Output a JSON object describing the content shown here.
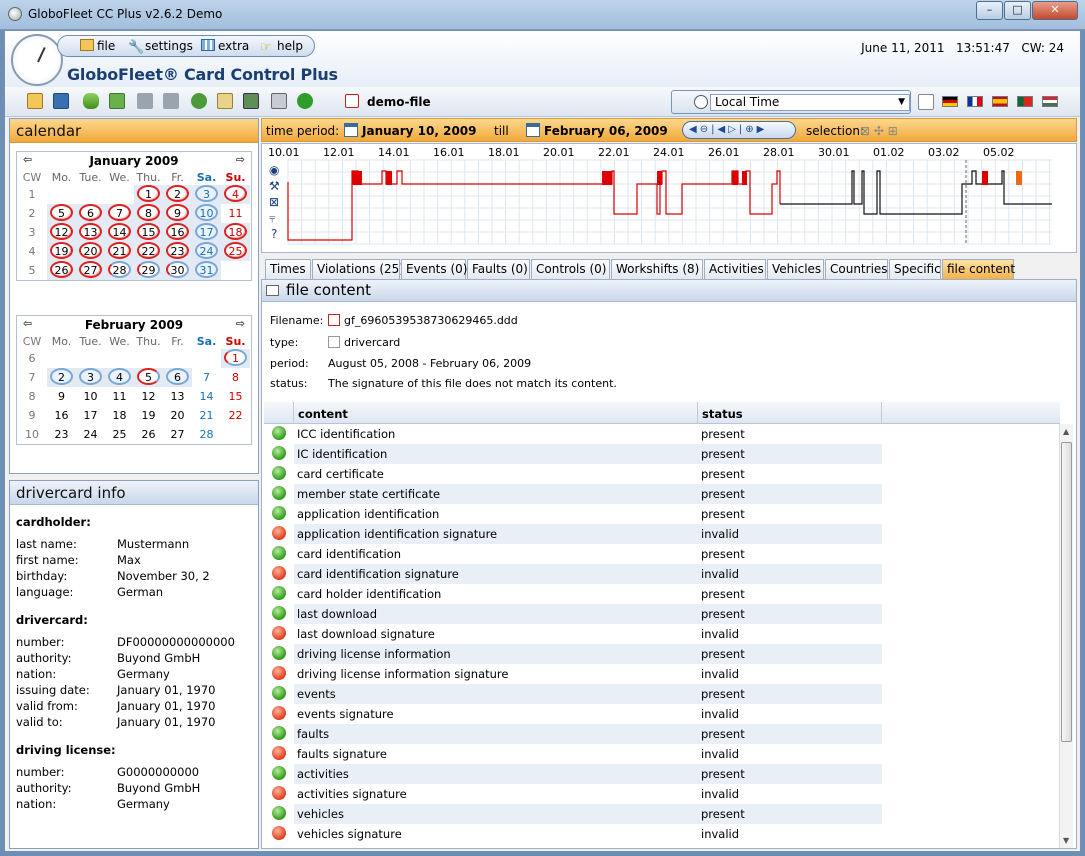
{
  "window": {
    "title": "GloboFleet CC Plus v2.6.2 Demo",
    "min": "–",
    "max": "□",
    "close": "✕"
  },
  "menu": {
    "file": "file",
    "settings": "settings",
    "extra": "extra",
    "help": "help"
  },
  "app_title": "GloboFleet® Card Control Plus",
  "header": {
    "date": "June 11, 2011",
    "time": "13:51:47",
    "cw": "CW: 24"
  },
  "toolbar": {
    "file_name": "demo-file",
    "timezone": "Local Time"
  },
  "calendar": {
    "title": "calendar",
    "weekdays": [
      "CW",
      "Mo.",
      "Tue.",
      "We.",
      "Thu.",
      "Fr.",
      "Sa.",
      "Su."
    ],
    "jan": {
      "title": "January 2009",
      "rows": [
        {
          "cw": "1",
          "days": [
            "",
            "",
            "",
            "1",
            "2",
            "3",
            "4"
          ],
          "s": [
            "",
            "",
            "",
            "r",
            "r",
            "b",
            "r"
          ]
        },
        {
          "cw": "2",
          "days": [
            "5",
            "6",
            "7",
            "8",
            "9",
            "10",
            "11"
          ],
          "s": [
            "r",
            "r",
            "r",
            "r",
            "r",
            "b",
            ""
          ]
        },
        {
          "cw": "3",
          "days": [
            "12",
            "13",
            "14",
            "15",
            "16",
            "17",
            "18"
          ],
          "s": [
            "r",
            "r",
            "r",
            "r",
            "r",
            "b",
            "r"
          ]
        },
        {
          "cw": "4",
          "days": [
            "19",
            "20",
            "21",
            "22",
            "23",
            "24",
            "25"
          ],
          "s": [
            "r",
            "r",
            "r",
            "r",
            "r",
            "b",
            "r"
          ]
        },
        {
          "cw": "5",
          "days": [
            "26",
            "27",
            "28",
            "29",
            "30",
            "31",
            ""
          ],
          "s": [
            "r",
            "r",
            "br",
            "br",
            "br",
            "b",
            ""
          ]
        }
      ]
    },
    "feb": {
      "title": "February 2009",
      "rows": [
        {
          "cw": "6",
          "days": [
            "",
            "",
            "",
            "",
            "",
            "",
            "1"
          ],
          "s": [
            "",
            "",
            "",
            "",
            "",
            "",
            "br"
          ]
        },
        {
          "cw": "7",
          "days": [
            "2",
            "3",
            "4",
            "5",
            "6",
            "7",
            "8"
          ],
          "s": [
            "b",
            "b",
            "b",
            "rb",
            "b",
            "",
            ""
          ]
        },
        {
          "cw": "8",
          "days": [
            "9",
            "10",
            "11",
            "12",
            "13",
            "14",
            "15"
          ],
          "s": [
            "",
            "",
            "",
            "",
            "",
            "",
            ""
          ]
        },
        {
          "cw": "9",
          "days": [
            "16",
            "17",
            "18",
            "19",
            "20",
            "21",
            "22"
          ],
          "s": [
            "",
            "",
            "",
            "",
            "",
            "",
            ""
          ]
        },
        {
          "cw": "10",
          "days": [
            "23",
            "24",
            "25",
            "26",
            "27",
            "28",
            ""
          ],
          "s": [
            "",
            "",
            "",
            "",
            "",
            "",
            ""
          ]
        }
      ]
    }
  },
  "drivercard_info": {
    "title": "drivercard info",
    "cardholder": {
      "title": "cardholder:",
      "rows": [
        [
          "last name:",
          "Mustermann"
        ],
        [
          "first name:",
          "Max"
        ],
        [
          "birthday:",
          "November 30, 2"
        ],
        [
          "language:",
          "German"
        ]
      ]
    },
    "drivercard": {
      "title": "drivercard:",
      "rows": [
        [
          "number:",
          "DF00000000000000"
        ],
        [
          "authority:",
          "Buyond GmbH"
        ],
        [
          "nation:",
          "Germany"
        ],
        [
          "issuing date:",
          "January 01, 1970"
        ],
        [
          "valid from:",
          "January 01, 1970"
        ],
        [
          "valid to:",
          "January 01, 1970"
        ]
      ]
    },
    "license": {
      "title": "driving license:",
      "rows": [
        [
          "number:",
          "G0000000000"
        ],
        [
          "authority:",
          "Buyond GmbH"
        ],
        [
          "nation:",
          "Germany"
        ]
      ]
    }
  },
  "time_period": {
    "label": "time period:",
    "from": "January 10, 2009",
    "till": "till",
    "to": "February 06, 2009",
    "selection": "selection:"
  },
  "timeline": {
    "dates": [
      "10.01",
      "12.01",
      "14.01",
      "16.01",
      "18.01",
      "20.01",
      "22.01",
      "24.01",
      "26.01",
      "28.01",
      "30.01",
      "01.02",
      "03.02",
      "05.02"
    ],
    "legend_unknown": "?"
  },
  "tabs": [
    "Times",
    "Violations (25)",
    "Events (0)",
    "Faults (0)",
    "Controls (0)",
    "Workshifts (8)",
    "Activities",
    "Vehicles",
    "Countries",
    "Specific",
    "file content"
  ],
  "file_content": {
    "title": "file content",
    "filename_label": "Filename:",
    "filename": "gf_6960539538730629465.ddd",
    "type_label": "type:",
    "type": "drivercard",
    "period_label": "period:",
    "period": "August 05, 2008 - February 06, 2009",
    "status_label": "status:",
    "status": "The signature of this file does not match its content.",
    "col_content": "content",
    "col_status": "status",
    "rows": [
      [
        "ICC identification",
        "present"
      ],
      [
        "IC identification",
        "present"
      ],
      [
        "card certificate",
        "present"
      ],
      [
        "member state certificate",
        "present"
      ],
      [
        "application identification",
        "present"
      ],
      [
        "application identification signature",
        "invalid"
      ],
      [
        "card identification",
        "present"
      ],
      [
        "card identification signature",
        "invalid"
      ],
      [
        "card holder identification",
        "present"
      ],
      [
        "last download",
        "present"
      ],
      [
        "last download signature",
        "invalid"
      ],
      [
        "driving license information",
        "present"
      ],
      [
        "driving license information signature",
        "invalid"
      ],
      [
        "events",
        "present"
      ],
      [
        "events signature",
        "invalid"
      ],
      [
        "faults",
        "present"
      ],
      [
        "faults signature",
        "invalid"
      ],
      [
        "activities",
        "present"
      ],
      [
        "activities signature",
        "invalid"
      ],
      [
        "vehicles",
        "present"
      ],
      [
        "vehicles signature",
        "invalid"
      ]
    ]
  }
}
